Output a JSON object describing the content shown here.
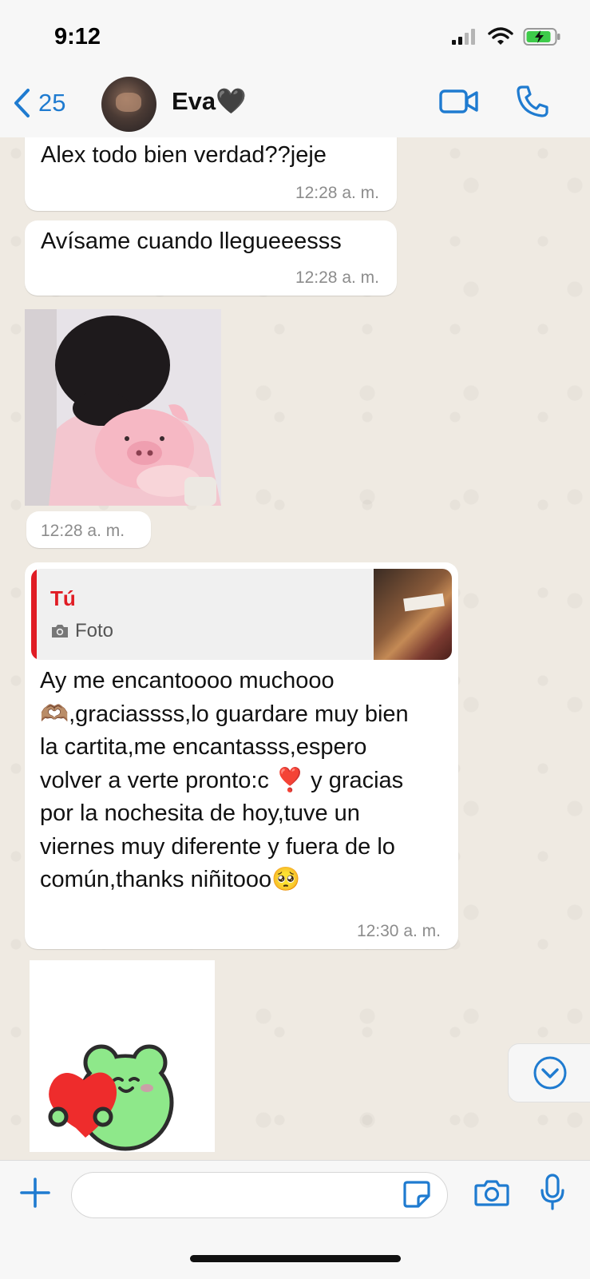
{
  "status_bar": {
    "time": "9:12"
  },
  "header": {
    "back_count": "25",
    "contact_name": "Eva🖤"
  },
  "messages": [
    {
      "type": "text",
      "text": "Alex todo bien verdad??jeje",
      "time": "12:28 a. m."
    },
    {
      "type": "text",
      "text": "Avísame cuando llegueeesss",
      "time": "12:28 a. m."
    },
    {
      "type": "image",
      "time": "12:28 a. m."
    },
    {
      "type": "reply",
      "quote": {
        "author": "Tú",
        "label": "Foto"
      },
      "text": "Ay me encantoooo muchooo 🫶🏽,graciassss,lo guardare muy bien la cartita,me encantasss,espero volver a verte pronto:c ❣️ y gracias por la nochesita de hoy,tuve un viernes muy diferente y fuera de lo común,thanks niñitooo🥺",
      "time": "12:30 a. m."
    },
    {
      "type": "sticker"
    }
  ],
  "input": {
    "placeholder": ""
  },
  "colors": {
    "accent_blue": "#1f7bd0",
    "quote_red": "#e01c24",
    "chat_background": "#efeae2"
  }
}
